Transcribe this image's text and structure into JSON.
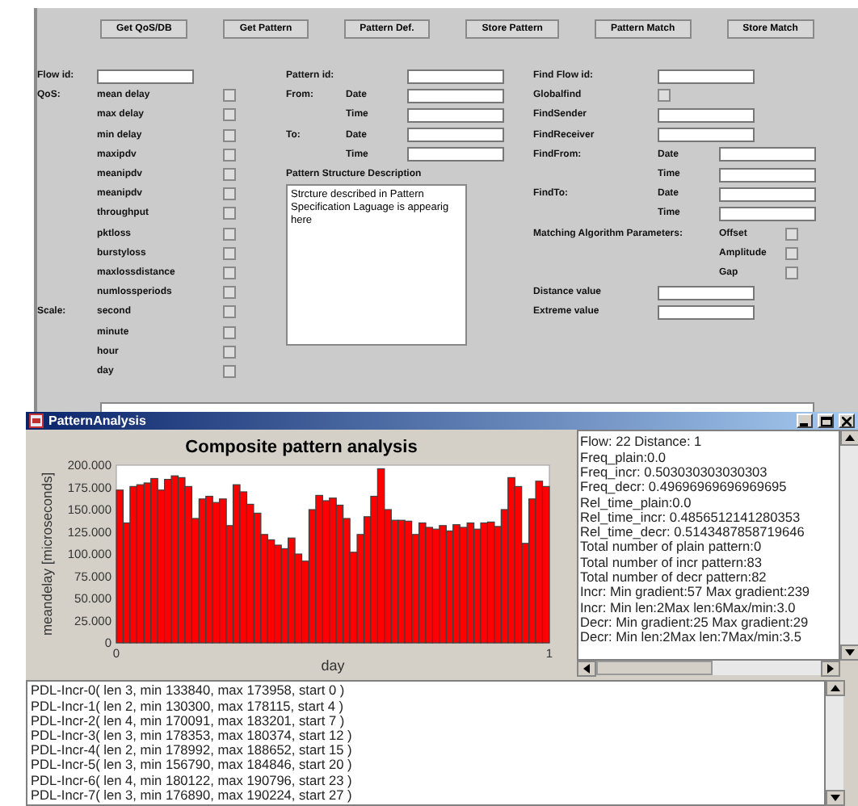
{
  "toolbar": {
    "buttons": [
      "Get QoS/DB",
      "Get Pattern",
      "Pattern Def.",
      "Store Pattern",
      "Pattern Match",
      "Store Match"
    ]
  },
  "form": {
    "columns": [
      {
        "rows": [
          {
            "kind": "field",
            "label": "Flow id:",
            "value": ""
          },
          {
            "kind": "checkbox",
            "label": "QoS:",
            "name": "mean delay",
            "checked": false
          },
          {
            "kind": "checkbox",
            "name": "max delay",
            "checked": false
          },
          {
            "kind": "checkbox",
            "name": "min delay",
            "checked": false
          },
          {
            "kind": "checkbox",
            "name": "maxipdv",
            "checked": false
          },
          {
            "kind": "checkbox",
            "name": "meanipdv",
            "checked": false
          },
          {
            "kind": "checkbox",
            "name": "meanipdv",
            "checked": false
          },
          {
            "kind": "checkbox",
            "name": "throughput",
            "checked": false
          },
          {
            "kind": "checkbox",
            "name": "pktloss",
            "checked": false
          },
          {
            "kind": "checkbox",
            "name": "burstyloss",
            "checked": false
          },
          {
            "kind": "checkbox",
            "name": "maxlossdistance",
            "checked": false
          },
          {
            "kind": "checkbox",
            "name": "numlossperiods",
            "checked": false
          },
          {
            "kind": "checkbox",
            "label": "Scale:",
            "name": "second",
            "checked": false
          },
          {
            "kind": "checkbox",
            "name": "minute",
            "checked": false
          },
          {
            "kind": "checkbox",
            "name": "hour",
            "checked": false
          },
          {
            "kind": "checkbox",
            "name": "day",
            "checked": false
          }
        ]
      },
      {
        "rows": [
          {
            "kind": "field",
            "label": "Pattern id:",
            "value": ""
          },
          {
            "kind": "date-field",
            "label": "From:",
            "name": "Date",
            "value": ""
          },
          {
            "kind": "date-field",
            "name": "Time",
            "value": ""
          },
          {
            "kind": "date-field",
            "label": "To:",
            "name": "Date",
            "value": ""
          },
          {
            "kind": "date-field",
            "name": "Time",
            "value": ""
          },
          {
            "kind": "heading",
            "label": "Pattern Structure Description"
          },
          {
            "kind": "textarea",
            "value": "Strcture described in Pattern Specification Laguage is appearig here"
          }
        ]
      },
      {
        "rows": [
          {
            "kind": "field",
            "label": "Find Flow id:",
            "value": ""
          },
          {
            "kind": "checkbox",
            "label": "Globalfind",
            "checked": false
          },
          {
            "kind": "field",
            "label": "FindSender",
            "value": ""
          },
          {
            "kind": "field",
            "label": "FindReceiver",
            "value": ""
          },
          {
            "kind": "date-field",
            "label": "FindFrom:",
            "name": "Date",
            "value": ""
          },
          {
            "kind": "date-field",
            "name": "Time",
            "value": ""
          },
          {
            "kind": "date-field",
            "label": "FindTo:",
            "name": "Date",
            "value": ""
          },
          {
            "kind": "date-field",
            "name": "Time",
            "value": ""
          },
          {
            "kind": "param-checkbox",
            "label": "Matching Algorithm Parameters:",
            "name": "Offset",
            "checked": false
          },
          {
            "kind": "param-checkbox",
            "name": "Amplitude",
            "checked": false
          },
          {
            "kind": "param-checkbox",
            "name": "Gap",
            "checked": false
          },
          {
            "kind": "field",
            "label": "Distance value",
            "value": ""
          },
          {
            "kind": "field",
            "label": "Extreme value",
            "value": ""
          }
        ]
      }
    ]
  },
  "window": {
    "title": "PatternAnalysis",
    "chart": {
      "chart_data": {
        "type": "bar",
        "title": "Composite pattern analysis",
        "xlabel": "day",
        "ylabel": "meandelay [microseconds]",
        "xlim": [
          0,
          1
        ],
        "ylim": [
          0,
          200
        ],
        "xticks": [
          0,
          1
        ],
        "yticks": [
          {
            "value": 0,
            "label": "0"
          },
          {
            "value": 25,
            "label": "25.000"
          },
          {
            "value": 50,
            "label": "50.000"
          },
          {
            "value": 75,
            "label": "75.000"
          },
          {
            "value": 100,
            "label": "100.000"
          },
          {
            "value": 125,
            "label": "125.000"
          },
          {
            "value": 150,
            "label": "150.000"
          },
          {
            "value": 175,
            "label": "175.000"
          },
          {
            "value": 200,
            "label": "200.000"
          }
        ],
        "x": [
          0,
          0.016,
          0.032,
          0.048,
          0.065,
          0.081,
          0.097,
          0.113,
          0.129,
          0.145,
          0.161,
          0.177,
          0.194,
          0.21,
          0.226,
          0.242,
          0.258,
          0.274,
          0.29,
          0.306,
          0.323,
          0.339,
          0.355,
          0.371,
          0.387,
          0.403,
          0.419,
          0.435,
          0.452,
          0.468,
          0.484,
          0.5,
          0.516,
          0.532,
          0.548,
          0.565,
          0.581,
          0.597,
          0.613,
          0.629,
          0.645,
          0.661,
          0.677,
          0.694,
          0.71,
          0.726,
          0.742,
          0.758,
          0.774,
          0.79,
          0.806,
          0.823,
          0.839,
          0.855,
          0.871,
          0.887,
          0.903,
          0.919,
          0.935,
          0.952,
          0.968,
          0.984,
          1
        ],
        "series": [
          {
            "color": "#ff0000",
            "values": [
              172,
              135,
              176,
              178,
              180,
              185,
              172,
              184,
              188,
              186,
              176,
              140,
              162,
              165,
              158,
              162,
              132,
              178,
              170,
              156,
              146,
              122,
              116,
              110,
              106,
              118,
              100,
              92,
              150,
              166,
              160,
              163,
              155,
              140,
              102,
              122,
              142,
              165,
              196,
              150,
              138,
              138,
              137,
              122,
              135,
              130,
              128,
              132,
              126,
              133,
              130,
              135,
              128,
              135,
              136,
              131,
              150,
              186,
              176,
              112,
              162,
              182,
              176
            ]
          }
        ]
      }
    },
    "info_lines": [
      "Flow: 22 Distance: 1",
      "Freq_plain:0.0",
      "Freq_incr: 0.503030303030303",
      "Freq_decr: 0.49696969696969695",
      "Rel_time_plain:0.0",
      "Rel_time_incr: 0.4856512141280353",
      "Rel_time_decr: 0.5143487858719646",
      "Total number of plain pattern:0",
      "Total number of incr pattern:83",
      "Total number of decr pattern:82",
      "Incr: Min gradient:57 Max gradient:239",
      "Incr: Min len:2Max len:6Max/min:3.0",
      "Decr: Min gradient:25 Max gradient:29",
      "Decr: Min len:2Max len:7Max/min:3.5"
    ],
    "pattern_lines": [
      "PDL-Incr-0(  len 3, min 133840, max 173958, start 0 )",
      "PDL-Incr-1(  len 2, min 130300, max 178115, start 4 )",
      "PDL-Incr-2(  len 4, min 170091, max 183201, start 7 )",
      "PDL-Incr-3(  len 3, min 178353, max 180374, start 12 )",
      "PDL-Incr-4(  len 2, min 178992, max 188652, start 15 )",
      "PDL-Incr-5(  len 3, min 156790, max 184846, start 20 )",
      "PDL-Incr-6(  len 4, min 180122, max 190796, start 23 )",
      "PDL-Incr-7(  len 3, min 176890, max 190224, start 27 )"
    ]
  }
}
